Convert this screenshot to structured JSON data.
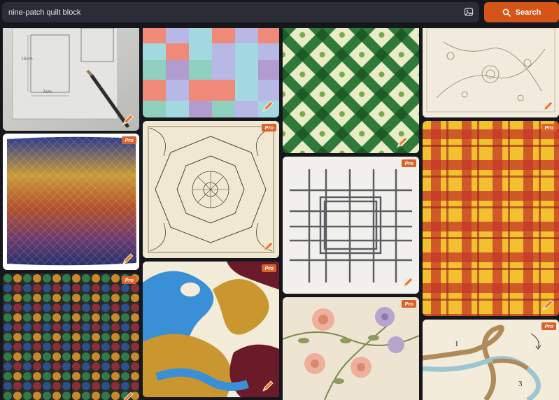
{
  "search": {
    "query": "nine-patch quilt block",
    "button_label": "Search"
  },
  "icons": {
    "image_search": "image-search-icon",
    "search": "magnifier-icon",
    "edit": "pencil-edit-icon"
  },
  "badge_label": "Pro",
  "results": [
    {
      "id": "t1",
      "caption": "",
      "pro": false
    },
    {
      "id": "t2",
      "pro": false
    },
    {
      "id": "t3",
      "pro": false
    },
    {
      "id": "t4",
      "pro": false
    },
    {
      "id": "t5",
      "pro": true
    },
    {
      "id": "t6",
      "pro": true
    },
    {
      "id": "t7",
      "pro": true
    },
    {
      "id": "t8",
      "pro": true
    },
    {
      "id": "t9",
      "pro": true
    },
    {
      "id": "t10",
      "pro": true
    },
    {
      "id": "t11",
      "pro": true
    },
    {
      "id": "t12",
      "pro": true
    },
    {
      "id": "t13",
      "pro": true
    }
  ],
  "sketch_labels": {
    "height": "15cm",
    "width": "7cm"
  },
  "rope_labels": {
    "a": "1",
    "b": "3"
  },
  "colors": {
    "accent": "#d4541a",
    "background": "#15171c",
    "search_field": "#2a2d35"
  }
}
